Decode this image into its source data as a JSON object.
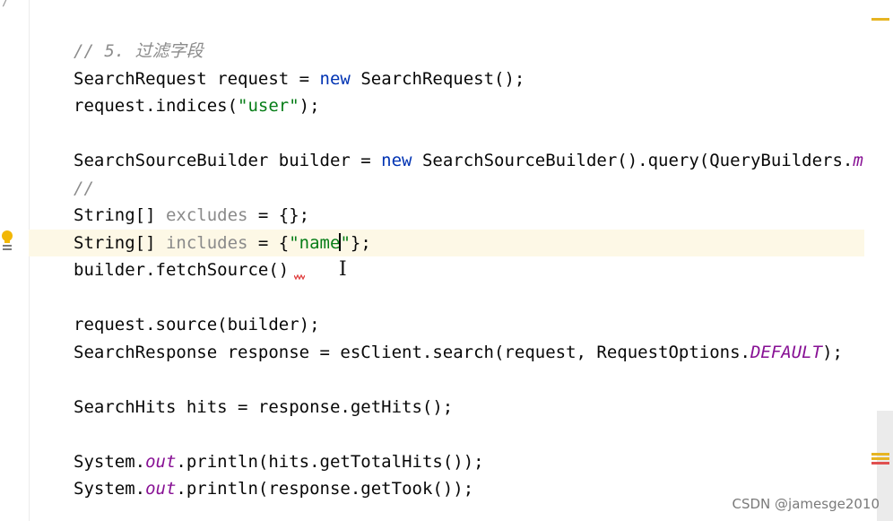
{
  "editor": {
    "lines": [
      {
        "parts": [
          {
            "t": "// 5. 过滤字段",
            "c": "cm"
          }
        ]
      },
      {
        "parts": [
          {
            "t": "SearchRequest request = "
          },
          {
            "t": "new",
            "c": "kw"
          },
          {
            "t": " SearchRequest();"
          }
        ]
      },
      {
        "parts": [
          {
            "t": "request.indices("
          },
          {
            "t": "\"user\"",
            "c": "str"
          },
          {
            "t": ");"
          }
        ]
      },
      {
        "parts": []
      },
      {
        "parts": [
          {
            "t": "SearchSourceBuilder builder = "
          },
          {
            "t": "new",
            "c": "kw"
          },
          {
            "t": " SearchSourceBuilder().query(QueryBuilders."
          },
          {
            "t": "mo",
            "c": "var"
          }
        ]
      },
      {
        "parts": [
          {
            "t": "//",
            "c": "cm"
          }
        ]
      },
      {
        "parts": [
          {
            "t": "String[] "
          },
          {
            "t": "excludes",
            "c": "unused"
          },
          {
            "t": " = {};"
          }
        ]
      },
      {
        "current": true,
        "parts": [
          {
            "t": "String[] "
          },
          {
            "t": "includes",
            "c": "unused"
          },
          {
            "t": " = {"
          },
          {
            "t": "\"name",
            "c": "str"
          },
          {
            "caret": true
          },
          {
            "t": "\"",
            "c": "str"
          },
          {
            "t": "};"
          }
        ]
      },
      {
        "parts": [
          {
            "t": "builder.fetchSource()"
          }
        ]
      },
      {
        "parts": []
      },
      {
        "parts": [
          {
            "t": "request.source(builder);"
          }
        ]
      },
      {
        "parts": [
          {
            "t": "SearchResponse response = esClient.search(request, RequestOptions."
          },
          {
            "t": "DEFAULT",
            "c": "var"
          },
          {
            "t": ");"
          }
        ]
      },
      {
        "parts": []
      },
      {
        "parts": [
          {
            "t": "SearchHits hits = response.getHits();"
          }
        ]
      },
      {
        "parts": []
      },
      {
        "parts": [
          {
            "t": "System."
          },
          {
            "t": "out",
            "c": "var"
          },
          {
            "t": ".println(hits.getTotalHits());"
          }
        ]
      },
      {
        "parts": [
          {
            "t": "System."
          },
          {
            "t": "out",
            "c": "var"
          },
          {
            "t": ".println(response.getTook());"
          }
        ]
      }
    ]
  },
  "gutter": {
    "fold_icon": "fold-arrow-icon",
    "intention_icon": "lightbulb-icon"
  },
  "scrollbar_marks": [
    {
      "color": "#e6b422",
      "kind": "warning-mark"
    },
    {
      "color": "#e6b422",
      "kind": "warning-mark"
    },
    {
      "color": "#e6b422",
      "kind": "warning-mark"
    },
    {
      "color": "#e05050",
      "kind": "error-mark"
    }
  ],
  "watermark": "CSDN @jamesge2010"
}
